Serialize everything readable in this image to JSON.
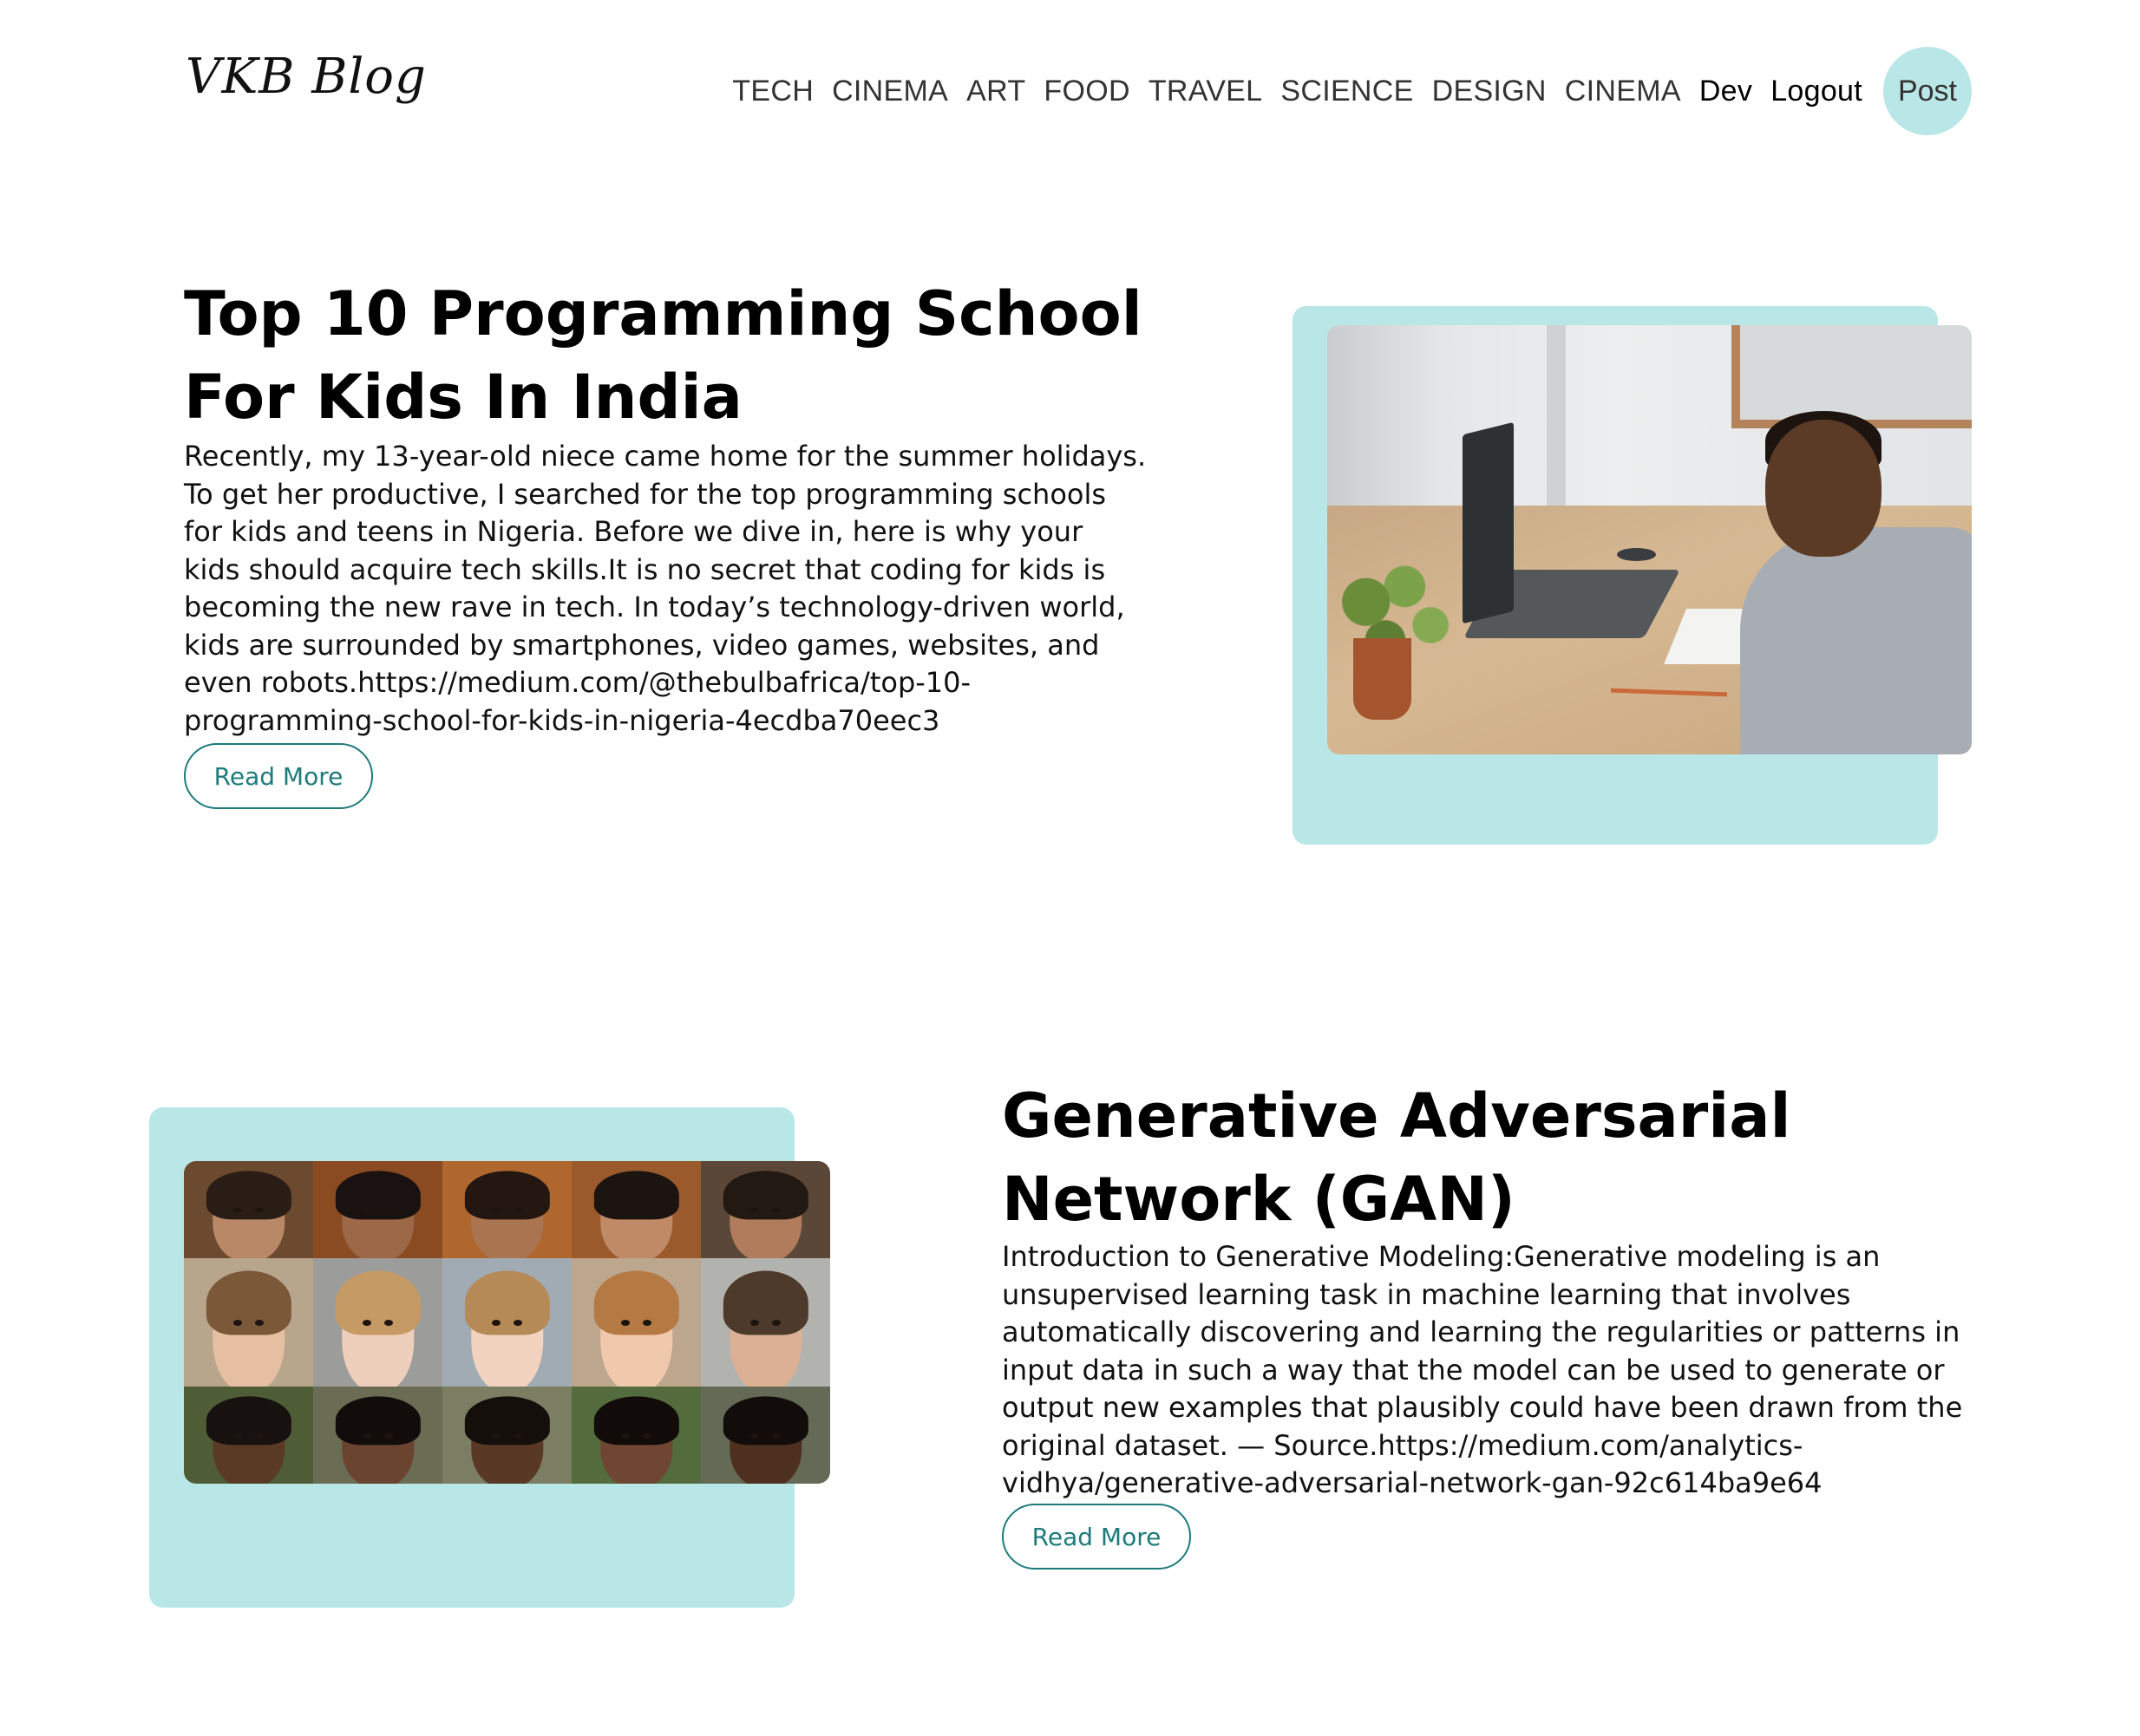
{
  "header": {
    "logo": "VKB Blog",
    "nav_items": [
      {
        "label": "TECH",
        "style": "light"
      },
      {
        "label": "CINEMA",
        "style": "light"
      },
      {
        "label": "ART",
        "style": "light"
      },
      {
        "label": "FOOD",
        "style": "light"
      },
      {
        "label": "TRAVEL",
        "style": "light"
      },
      {
        "label": "SCIENCE",
        "style": "light"
      },
      {
        "label": "DESIGN",
        "style": "light"
      },
      {
        "label": "CINEMA",
        "style": "light"
      },
      {
        "label": "Dev",
        "style": "dark"
      },
      {
        "label": "Logout",
        "style": "dark"
      }
    ],
    "post_button": "Post"
  },
  "posts": [
    {
      "title": "Top 10 Programming School For Kids In India",
      "description": "Recently, my 13-year-old niece came home for the summer holidays. To get her productive, I searched for the top programming schools for kids and teens in Nigeria. Before we dive in, here is why your kids should acquire tech skills.It is no secret that coding for kids is becoming the new rave in tech. In today’s technology-driven world, kids are surrounded by smartphones, video games, websites, and even robots.https://medium.com/@thebulbafrica/top-10-programming-school-for-kids-in-nigeria-4ecdba70eec3",
      "read_more": "Read More",
      "image_icon": "kid-at-laptop-photo"
    },
    {
      "title": "Generative Adversarial Network (GAN)",
      "description": "Introduction to Generative Modeling:Generative modeling is an unsupervised learning task in machine learning that involves automatically discovering and learning the regularities or patterns in input data in such a way that the model can be used to generate or output new examples that plausibly could have been drawn from the original dataset. — Source.https://medium.com/analytics-vidhya/generative-adversarial-network-gan-92c614ba9e64",
      "read_more": "Read More",
      "image_icon": "generated-faces-grid-photo"
    }
  ],
  "colors": {
    "accent_teal": "#b9e6e6",
    "button_teal": "#1e7b7b"
  }
}
